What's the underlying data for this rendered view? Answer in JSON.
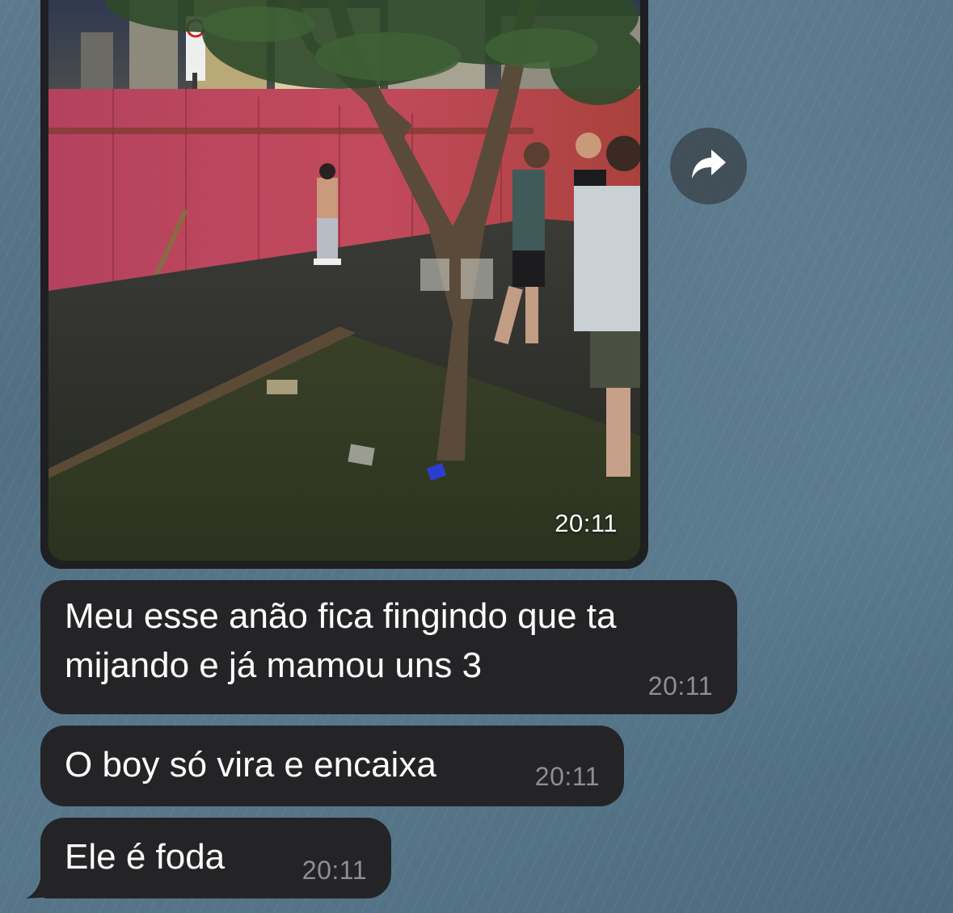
{
  "chat": {
    "photo_message": {
      "time": "20:11"
    },
    "forward_button": {
      "icon": "forward-arrow-icon"
    },
    "messages": [
      {
        "text": "Meu esse anão fica fingindo que ta\nmijando e já mamou uns 3",
        "time": "20:11"
      },
      {
        "text": "O boy só vira e encaixa",
        "time": "20:11"
      },
      {
        "text": "Ele é foda",
        "time": "20:11"
      }
    ]
  },
  "colors": {
    "bubble_background": "#242426",
    "timestamp_gray": "#8e8e93",
    "wallpaper": "#56768a"
  }
}
